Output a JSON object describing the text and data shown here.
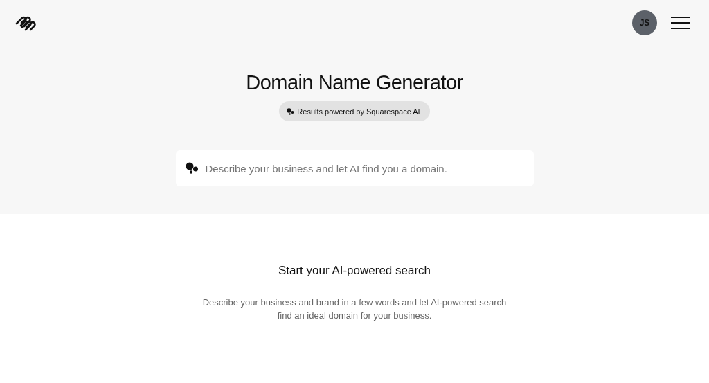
{
  "header": {
    "avatar": "JS"
  },
  "hero": {
    "title": "Domain Name Generator",
    "badge": "Results powered by Squarespace AI"
  },
  "search": {
    "placeholder": "Describe your business and let AI find you a domain."
  },
  "intro": {
    "heading": "Start your AI-powered search",
    "text": "Describe your business and brand in a few words and let AI-powered search find an ideal domain for your business."
  }
}
